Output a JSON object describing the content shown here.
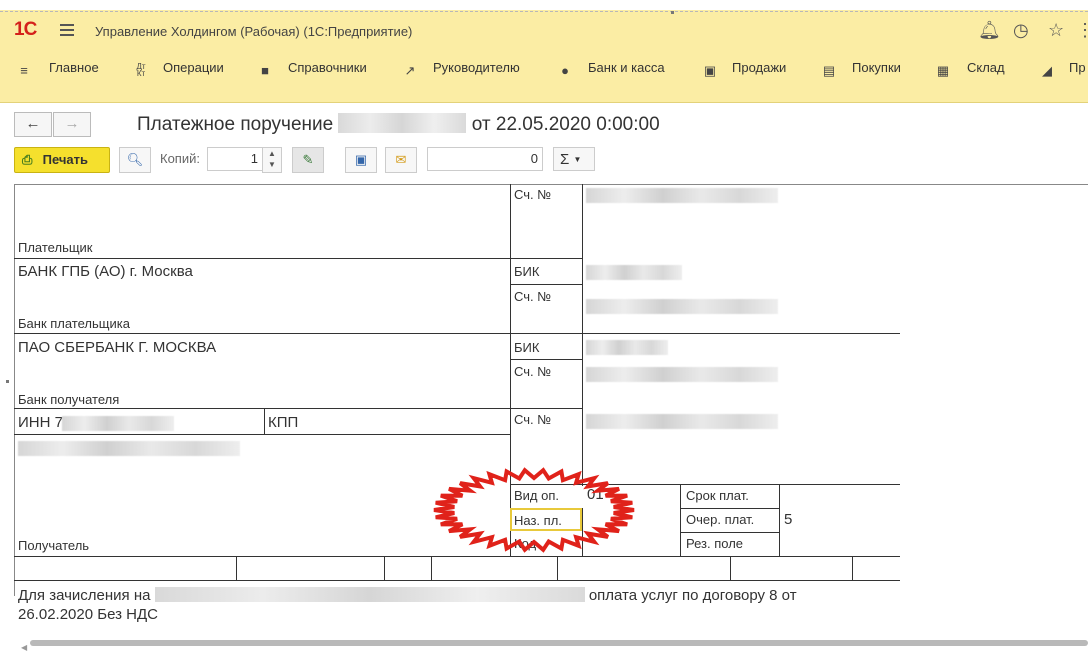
{
  "app": {
    "logo": "1С",
    "title": "Управление Холдингом (Рабочая)  (1С:Предприятие)"
  },
  "menu": [
    {
      "label": "Главное",
      "icon": "hamburger-icon"
    },
    {
      "label": "Операции",
      "icon": "operations-icon"
    },
    {
      "label": "Справочники",
      "icon": "directory-icon"
    },
    {
      "label": "Руководителю",
      "icon": "chart-trend-icon"
    },
    {
      "label": "Банк и касса",
      "icon": "coin-icon"
    },
    {
      "label": "Продажи",
      "icon": "bag-icon"
    },
    {
      "label": "Покупки",
      "icon": "cart-icon"
    },
    {
      "label": "Склад",
      "icon": "warehouse-icon"
    },
    {
      "label": "Пр",
      "icon": "production-icon"
    }
  ],
  "document": {
    "title_prefix": "Платежное поручение",
    "title_suffix": "от 22.05.2020 0:00:00"
  },
  "toolbar": {
    "print_label": "Печать",
    "copies_label": "Копий:",
    "copies_value": "1",
    "sum_value": "0",
    "sigma": "Σ"
  },
  "form": {
    "payer_label": "Плательщик",
    "acc_no_label": "Сч. №",
    "bik_label": "БИК",
    "payer_bank_name": "БАНК ГПБ (АО) г. Москва",
    "payer_bank_label": "Банк плательщика",
    "recipient_bank_name": "ПАО СБЕРБАНК Г. МОСКВА",
    "recipient_bank_label": "Банк получателя",
    "inn_label": "ИНН 7",
    "kpp_label": "КПП",
    "recipient_label": "Получатель",
    "op_type_label": "Вид оп.",
    "op_type_value": "01",
    "purpose_label": "Наз. пл.",
    "code_label": "Код",
    "term_label": "Срок плат.",
    "priority_label": "Очер. плат.",
    "priority_value": "5",
    "reserve_label": "Рез. поле",
    "purpose_prefix": "Для зачисления на",
    "purpose_suffix": "оплата услуг по договору 8 от",
    "purpose_line2": "26.02.2020 Без НДС"
  },
  "colors": {
    "header_bg": "#fbeda4",
    "print_button": "#f5e02d",
    "stamp": "#e0221a",
    "focus_frame": "#e8c93b"
  }
}
